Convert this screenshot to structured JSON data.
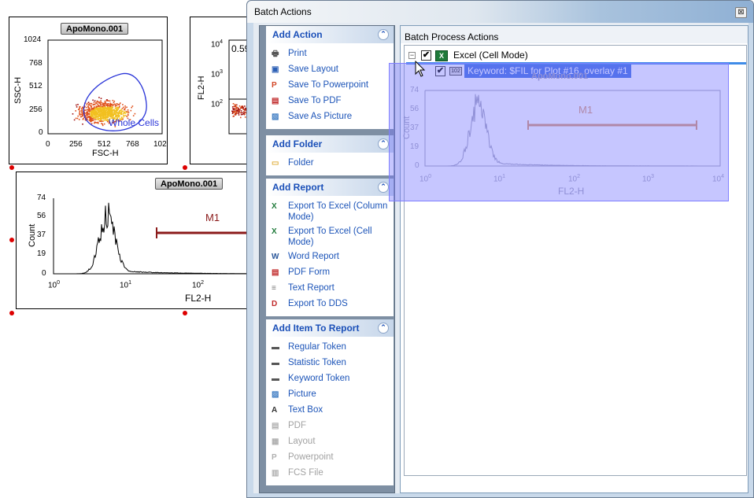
{
  "dialog": {
    "title": "Batch Actions",
    "close_glyph": "⊠",
    "right_panel_title": "Batch Process Actions"
  },
  "groups": [
    {
      "title": "Add Action",
      "items": [
        {
          "label": "Print",
          "icon": "printer-icon",
          "enabled": true
        },
        {
          "label": "Save Layout",
          "icon": "save-icon",
          "enabled": true
        },
        {
          "label": "Save To Powerpoint",
          "icon": "powerpoint-icon",
          "enabled": true
        },
        {
          "label": "Save To PDF",
          "icon": "pdf-icon",
          "enabled": true
        },
        {
          "label": "Save As Picture",
          "icon": "picture-icon",
          "enabled": true
        }
      ]
    },
    {
      "title": "Add Folder",
      "items": [
        {
          "label": "Folder",
          "icon": "folder-icon",
          "enabled": true
        }
      ]
    },
    {
      "title": "Add Report",
      "items": [
        {
          "label": "Export To Excel (Column Mode)",
          "icon": "excel-icon",
          "enabled": true
        },
        {
          "label": "Export To Excel (Cell Mode)",
          "icon": "excel-icon",
          "enabled": true
        },
        {
          "label": "Word Report",
          "icon": "word-icon",
          "enabled": true
        },
        {
          "label": "PDF Form",
          "icon": "pdf-form-icon",
          "enabled": true
        },
        {
          "label": "Text Report",
          "icon": "text-report-icon",
          "enabled": true
        },
        {
          "label": "Export To DDS",
          "icon": "dds-icon",
          "enabled": true
        }
      ]
    },
    {
      "title": "Add Item To Report",
      "items": [
        {
          "label": "Regular Token",
          "icon": "token-icon",
          "enabled": true
        },
        {
          "label": "Statistic Token",
          "icon": "token-icon",
          "enabled": true
        },
        {
          "label": "Keyword Token",
          "icon": "token-icon",
          "enabled": true
        },
        {
          "label": "Picture",
          "icon": "picture-icon",
          "enabled": true
        },
        {
          "label": "Text Box",
          "icon": "textbox-icon",
          "enabled": true
        },
        {
          "label": "PDF",
          "icon": "pdf-icon",
          "enabled": false
        },
        {
          "label": "Layout",
          "icon": "layout-icon",
          "enabled": false
        },
        {
          "label": "Powerpoint",
          "icon": "powerpoint-icon",
          "enabled": false
        },
        {
          "label": "FCS File",
          "icon": "fcs-file-icon",
          "enabled": false
        }
      ]
    }
  ],
  "tree": {
    "root": {
      "label": "Excel (Cell Mode)",
      "expander": "−",
      "checked": "✔",
      "icon_text": "X"
    },
    "child": {
      "label": "Keyword: $FIL for Plot #16, overlay #1",
      "checked": "✔",
      "icon_text": "102"
    }
  },
  "plots": {
    "scatter1": {
      "title": "ApoMono.001",
      "xlabel": "FSC-H",
      "ylabel": "SSC-H",
      "xticks": [
        "0",
        "256",
        "512",
        "768",
        "102"
      ],
      "yticks": [
        "1024",
        "768",
        "512",
        "256",
        "0"
      ],
      "gate_label": "Whole Cells"
    },
    "scatter2": {
      "ylabel": "FL2-H",
      "yticks": [
        "10",
        "10",
        "10"
      ],
      "ytick_exps": [
        "4",
        "3",
        "2"
      ],
      "value_text": "0.59"
    },
    "histogram": {
      "title": "ApoMono.001",
      "xlabel": "FL2-H",
      "ylabel": "Count",
      "yticks": [
        "74",
        "56",
        "37",
        "19",
        "0"
      ],
      "xticks": [
        "10",
        "10",
        "10"
      ],
      "xtick_exps": [
        "0",
        "1",
        "2"
      ],
      "marker_label": "M1"
    },
    "ghost": {
      "title": "ApoMono.001",
      "xlabel": "FL2-H",
      "ylabel": "Count",
      "yticks": [
        "74",
        "56",
        "37",
        "19",
        "0"
      ],
      "xticks": [
        "10",
        "10",
        "10",
        "10",
        "10"
      ],
      "xtick_exps": [
        "0",
        "1",
        "2",
        "3",
        "4"
      ],
      "marker_label": "M1"
    }
  },
  "colors": {
    "link_blue": "#1c54b8",
    "selection_blue": "#3f6fe0",
    "marker_red": "#8b1a1a",
    "gate_blue": "#2a35d8"
  }
}
